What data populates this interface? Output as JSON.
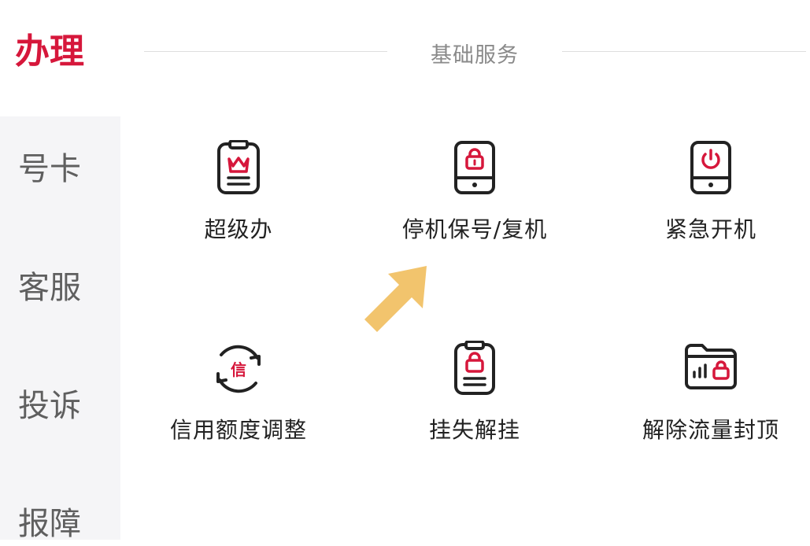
{
  "sidebar": {
    "items": [
      {
        "label": "办理",
        "active": true
      },
      {
        "label": "号卡"
      },
      {
        "label": "客服"
      },
      {
        "label": "投诉"
      },
      {
        "label": "报障"
      }
    ]
  },
  "section": {
    "title": "基础服务"
  },
  "services": [
    {
      "label": "超级办",
      "icon": "clipboard-crown-icon"
    },
    {
      "label": "停机保号/复机",
      "icon": "phone-lock-icon"
    },
    {
      "label": "紧急开机",
      "icon": "phone-power-icon"
    },
    {
      "label": "信用额度调整",
      "icon": "credit-cycle-icon"
    },
    {
      "label": "挂失解挂",
      "icon": "badge-lock-icon"
    },
    {
      "label": "解除流量封顶",
      "icon": "folder-data-lock-icon"
    }
  ],
  "colors": {
    "accent": "#d6173b",
    "arrow": "#f2c46d",
    "icon_stroke": "#222222"
  }
}
